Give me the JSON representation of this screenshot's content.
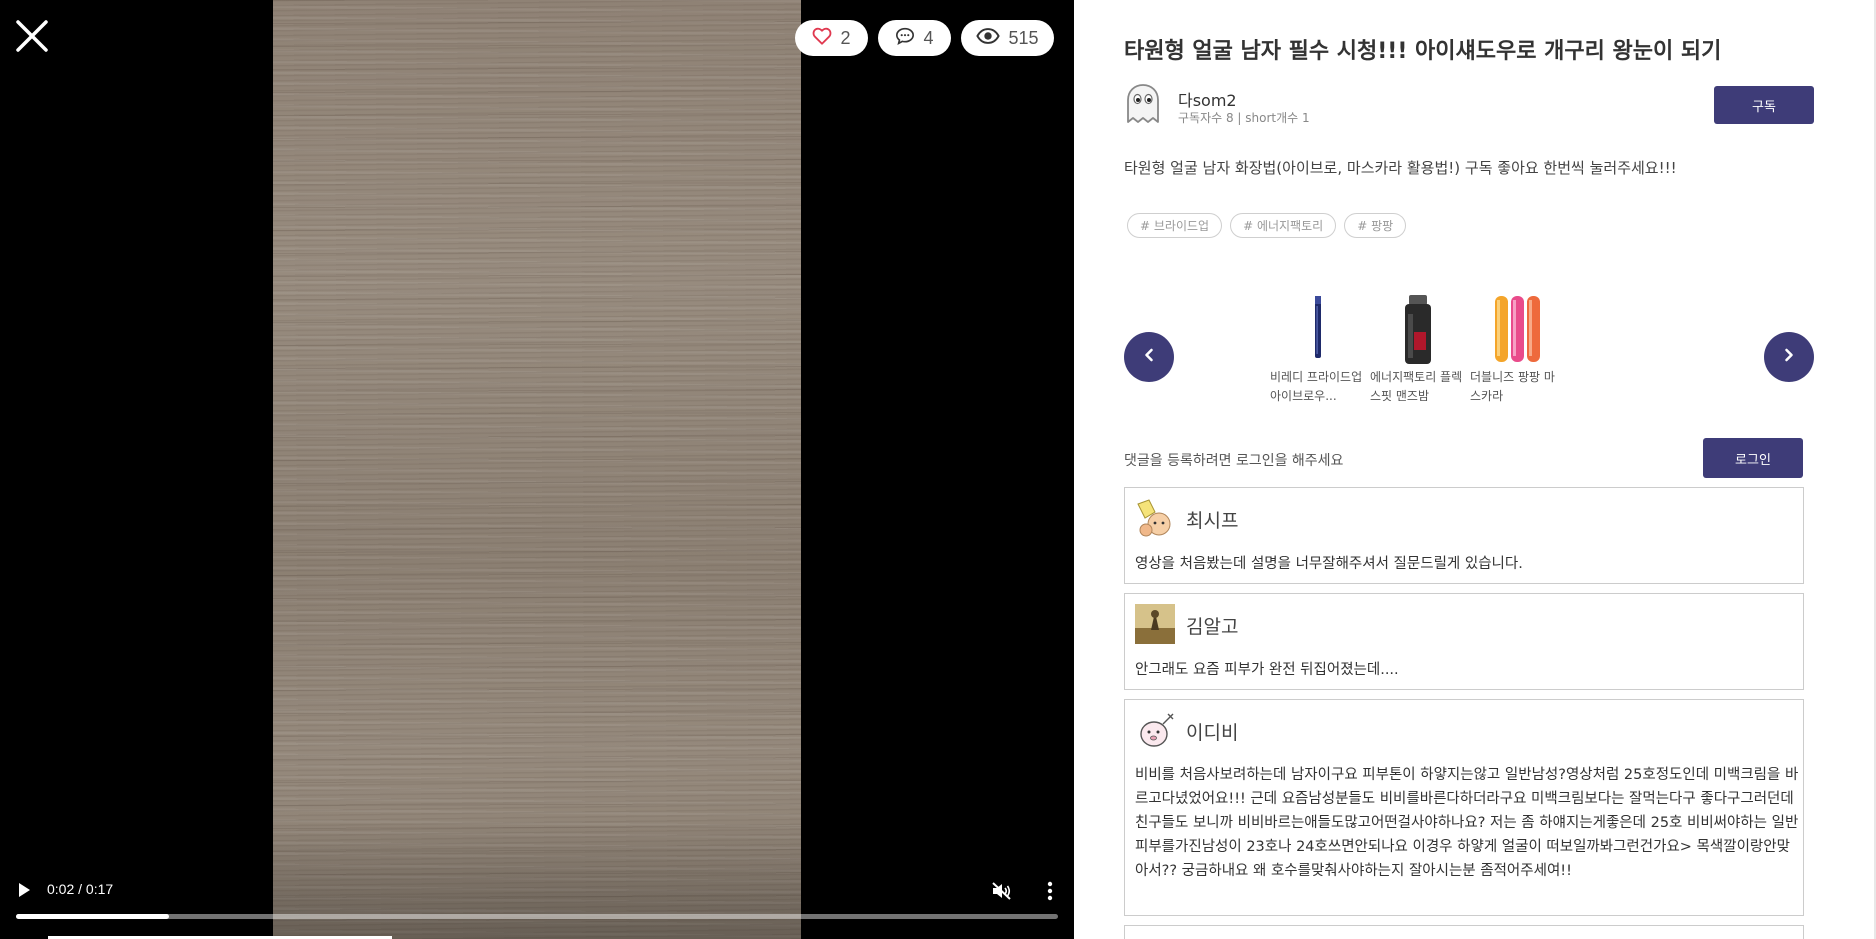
{
  "video": {
    "stats": {
      "likes": "2",
      "comments": "4",
      "views": "515"
    },
    "time_display": "0:02 / 0:17",
    "progress": 0.147
  },
  "post": {
    "title": "타원형 얼굴 남자 필수 시청!!! 아이섀도우로 개구리 왕눈이 되기",
    "author": {
      "name": "다som2",
      "meta": "구독자수 8 | short개수 1"
    },
    "subscribe_label": "구독",
    "description": "타원형 얼굴 남자 화장법(아이브로, 마스카라 활용법!) 구독 좋아요 한번씩 눌러주세요!!!",
    "tags": [
      "# 브라이드업",
      "# 에너지팩토리",
      "# 팡팡"
    ]
  },
  "products": [
    {
      "name": "비레디 프라이드업 아이브로우...",
      "icon": "eyebrow-pencil-icon",
      "color": "#1e2a6a"
    },
    {
      "name": "에너지팩토리 플렉스핏 맨즈밤",
      "icon": "balm-bottle-icon",
      "color": "#2a2a2a"
    },
    {
      "name": "더블니즈 팡팡 마스카라",
      "icon": "mascara-tubes-icon",
      "color": "#e94b8b"
    }
  ],
  "comments_section": {
    "prompt": "댓글을 등록하려면 로그인을 해주세요",
    "login_label": "로그인",
    "items": [
      {
        "author": "최시프",
        "text": "영상을 처음봤는데 설명을 너무잘해주셔서 질문드릴게 있습니다."
      },
      {
        "author": "김알고",
        "text": "안그래도 요즘 피부가 완전 뒤집어졌는데...."
      },
      {
        "author": "이디비",
        "text": "비비를 처음사보려하는데 남자이구요 피부톤이 하얗지는않고 일반남성?영상처럼 25호정도인데 미백크림을 바르고다녔었어요!!! 근데 요즘남성분들도 비비를바른다하더라구요 미백크림보다는 잘먹는다구 좋다구그러던데 친구들도 보니까 비비바르는애들도많고어떤걸사야하나요? 저는 좀 하얘지는게좋은데 25호 비비써야하는 일반피부를가진남성이 23호나 24호쓰면안되나요 이경우 하얗게 얼굴이 떠보일까봐그런건가요> 목색깔이랑안맞아서?? 궁금하내요 왜 호수를맞춰사야하는지 잘아시는분 좀적어주세여!!"
      }
    ]
  },
  "colors": {
    "accent": "#3e3c78",
    "like_heart": "#e0384f"
  }
}
